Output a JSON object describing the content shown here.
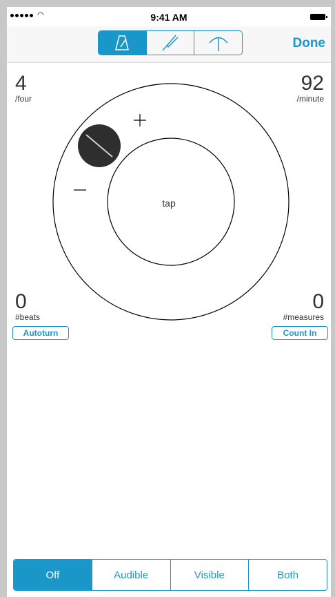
{
  "status_bar": {
    "time": "9:41 AM"
  },
  "navbar": {
    "tools": [
      {
        "icon": "metronome-icon",
        "selected": true
      },
      {
        "icon": "tuning-fork-icon",
        "selected": false
      },
      {
        "icon": "fermata-icon",
        "selected": false
      }
    ],
    "done_label": "Done"
  },
  "time_signature": {
    "value": "4",
    "unit": "/four"
  },
  "tempo": {
    "value": "92",
    "unit": "/minute"
  },
  "dial": {
    "plus_label": "+",
    "minus_label": "–",
    "tap_label": "tap",
    "knob_icon": "tempo-knob-icon"
  },
  "beats": {
    "value": "0",
    "unit": "#beats",
    "button_label": "Autoturn"
  },
  "measures": {
    "value": "0",
    "unit": "#measures",
    "button_label": "Count In"
  },
  "mode_selector": {
    "options": [
      "Off",
      "Audible",
      "Visible",
      "Both"
    ],
    "selected": "Off"
  },
  "colors": {
    "accent": "#1a97c9",
    "knob": "#2e2e2e",
    "frame": "#c8c8c8"
  }
}
